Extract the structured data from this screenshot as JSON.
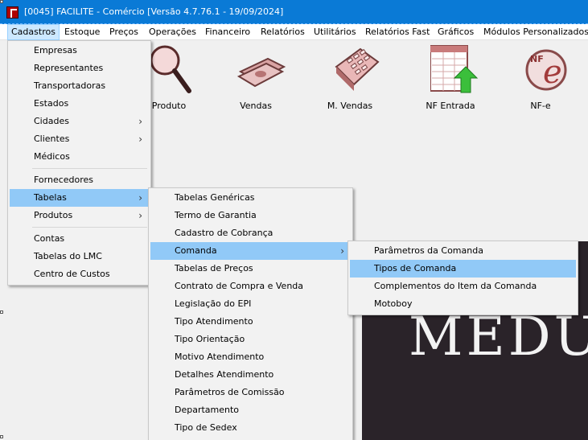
{
  "window": {
    "title": "[0045] FACILITE - Comércio [Versão 4.7.76.1 - 19/09/2024]"
  },
  "menubar": {
    "items": [
      "Cadastros",
      "Estoque",
      "Preços",
      "Operações",
      "Financeiro",
      "Relatórios",
      "Utilitários",
      "Relatórios Fast",
      "Gráficos",
      "Módulos Personalizados"
    ]
  },
  "toolbar": {
    "buttons": [
      {
        "label": "Produto",
        "icon": "magnifier-icon"
      },
      {
        "label": "Vendas",
        "icon": "money-icon"
      },
      {
        "label": "M. Vendas",
        "icon": "calculator-icon"
      },
      {
        "label": "NF Entrada",
        "icon": "nf-entrada-icon"
      },
      {
        "label": "NF-e",
        "icon": "nfe-icon"
      }
    ]
  },
  "cadastros_menu": {
    "items": [
      "Empresas",
      "Representantes",
      "Transportadoras",
      "Estados",
      "Cidades",
      "Clientes",
      "Médicos",
      "Fornecedores",
      "Tabelas",
      "Produtos",
      "Contas",
      "Tabelas do LMC",
      "Centro de Custos"
    ]
  },
  "tabelas_menu": {
    "items": [
      "Tabelas Genéricas",
      "Termo de Garantia",
      "Cadastro de Cobrança",
      "Comanda",
      "Tabelas de Preços",
      "Contrato de Compra e Venda",
      "Legislação do EPI",
      "Tipo Atendimento",
      "Tipo Orientação",
      "Motivo Atendimento",
      "Detalhes Atendimento",
      "Parâmetros de Comissão",
      "Departamento",
      "Tipo de Sedex"
    ]
  },
  "comanda_menu": {
    "items": [
      "Parâmetros da Comanda",
      "Tipos de Comanda",
      "Complementos do Item da Comanda",
      "Motoboy"
    ]
  },
  "background": {
    "banner_text": "MEDU"
  },
  "colors": {
    "titlebar": "#0a7ad6",
    "menu_highlight": "#91c9f7",
    "banner": "#2a2329"
  }
}
